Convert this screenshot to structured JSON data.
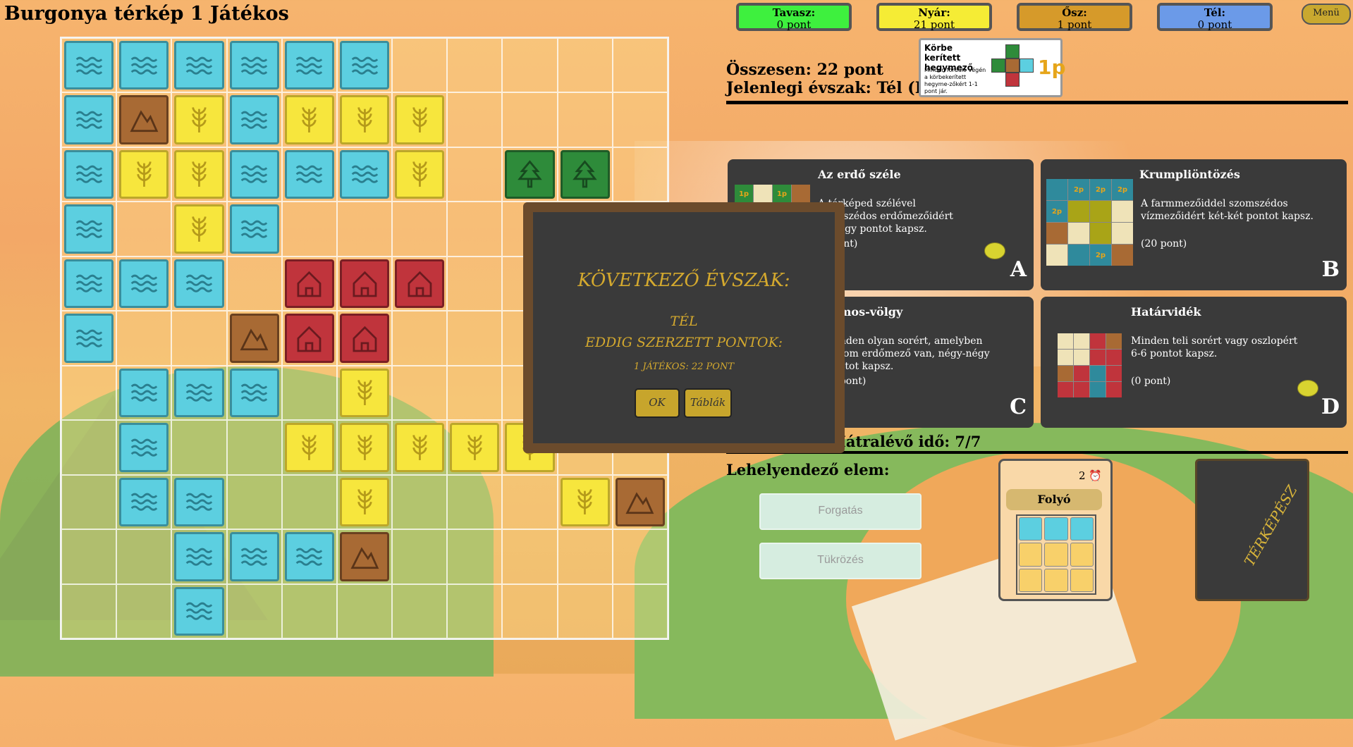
{
  "title": "Burgonya térkép 1 Játékos",
  "menu_label": "Menü",
  "seasons": [
    {
      "name": "Tavasz:",
      "points": "0 pont",
      "color": "#3ef03e"
    },
    {
      "name": "Nyár:",
      "points": "21 pont",
      "color": "#f5ec35"
    },
    {
      "name": "Ősz:",
      "points": "1 pont",
      "color": "#d69a2a"
    },
    {
      "name": "Tél:",
      "points": "0 pont",
      "color": "#6b9ae8"
    }
  ],
  "total": "Összesen: 22 pont",
  "current_season": "Jelenlegi évszak: Tél (DA)",
  "small_mission": {
    "title": "Körbe kerített hegymező",
    "desc": "Minden forduló végén a körbekerített hegyme-zőkért 1-1 pont jár.",
    "points": "1p"
  },
  "board": {
    "size": 11,
    "rows": [
      "wwwwww.....",
      "wMFwFFF....",
      "wFFwwwF.TT.",
      "w.Fw.......",
      "www.HHH....",
      "w..MHH.....",
      ".www.F...F.",
      ".w..FFFFF..",
      ".ww..F...FM",
      "..wwwM.....",
      "..w........"
    ]
  },
  "cards": {
    "A": {
      "title": "Az erdő széle",
      "desc": "A térképed szélével szomszédos erdőmezőidért egy-egy pontot kapsz.",
      "points": "(0 pont)",
      "letter": "A"
    },
    "B": {
      "title": "Krumpliöntözés",
      "desc": "A farmmezőiddel szomszédos vízmezőidért két-két pontot kapsz.",
      "points": "(20 pont)",
      "letter": "B"
    },
    "C": {
      "title": "Álmos-völgy",
      "desc": "Minden olyan sorért, amelyben három erdőmező van, négy-négy pontot kapsz.",
      "points": "(0 pont)",
      "letter": "C"
    },
    "D": {
      "title": "Határvidék",
      "desc": "Minden teli sorért vagy oszlopért 6-6 pontot kapsz.",
      "points": "(0 pont)",
      "letter": "D"
    }
  },
  "remaining_time": "Hátralévő idő: 7/7",
  "element_label": "Lehelyendező elem:",
  "rotate_label": "Forgatás",
  "mirror_label": "Tükrözés",
  "piece": {
    "time": "2",
    "name": "Folyó"
  },
  "deck_label": "TÉRKÉPÉSZ",
  "modal": {
    "heading": "KÖVETKEZŐ ÉVSZAK:",
    "season": "TÉL",
    "points_heading": "EDDIG SZERZETT PONTOK:",
    "player_points": "1 JÁTÉKOS: 22 PONT",
    "ok_label": "OK",
    "tables_label": "Táblák"
  },
  "colors": {
    "water": "#5ccfe0",
    "farm": "#f7e63d",
    "forest": "#2e8b3a",
    "town": "#c0343c",
    "mountain": "#a86a34"
  }
}
